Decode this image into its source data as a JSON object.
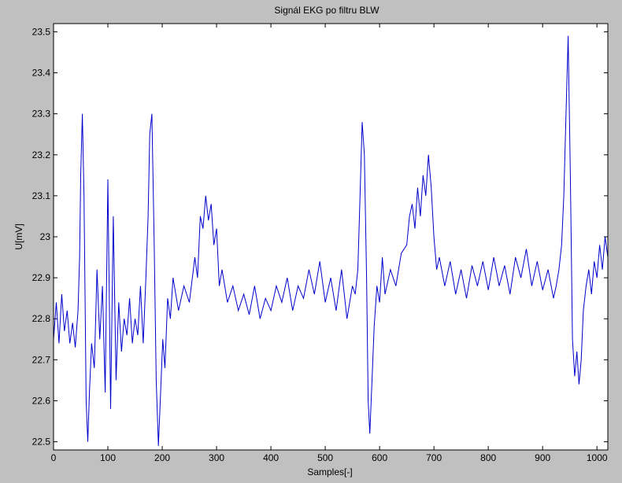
{
  "figure": {
    "background": "#c0c0c0",
    "axes_background": "#ffffff",
    "line_color": "#0000cc"
  },
  "chart_data": {
    "type": "line",
    "title": "Signál EKG po filtru BLW",
    "xlabel": "Samples[-]",
    "ylabel": "U[mV]",
    "xlim": [
      0,
      1020
    ],
    "ylim": [
      22.48,
      23.52
    ],
    "xticks": [
      0,
      100,
      200,
      300,
      400,
      500,
      600,
      700,
      800,
      900,
      1000
    ],
    "xtick_labels": [
      "0",
      "100",
      "200",
      "300",
      "400",
      "500",
      "600",
      "700",
      "800",
      "900",
      "1000"
    ],
    "yticks": [
      22.5,
      22.6,
      22.7,
      22.8,
      22.9,
      23.0,
      23.1,
      23.2,
      23.3,
      23.4,
      23.5
    ],
    "ytick_labels": [
      "22.5",
      "22.6",
      "22.7",
      "22.8",
      "22.9",
      "23",
      "23.1",
      "23.2",
      "23.3",
      "23.4",
      "23.5"
    ],
    "grid": false,
    "series": [
      {
        "color": "#0000cc",
        "x": [
          0,
          5,
          10,
          15,
          20,
          25,
          30,
          35,
          40,
          45,
          48,
          50,
          53,
          56,
          60,
          63,
          66,
          70,
          75,
          80,
          85,
          90,
          95,
          100,
          105,
          110,
          115,
          120,
          125,
          130,
          135,
          140,
          145,
          150,
          155,
          160,
          165,
          170,
          174,
          177,
          181,
          185,
          189,
          193,
          197,
          201,
          205,
          210,
          215,
          220,
          230,
          240,
          250,
          260,
          265,
          270,
          275,
          280,
          285,
          290,
          295,
          300,
          305,
          310,
          320,
          330,
          340,
          350,
          360,
          370,
          380,
          390,
          400,
          410,
          420,
          430,
          440,
          450,
          460,
          470,
          480,
          490,
          500,
          510,
          520,
          530,
          540,
          550,
          555,
          560,
          564,
          568,
          572,
          576,
          579,
          582,
          586,
          590,
          595,
          600,
          605,
          610,
          620,
          630,
          640,
          650,
          655,
          660,
          665,
          670,
          675,
          680,
          685,
          690,
          695,
          700,
          705,
          710,
          720,
          730,
          740,
          750,
          760,
          770,
          780,
          790,
          800,
          810,
          820,
          830,
          840,
          850,
          860,
          870,
          880,
          890,
          900,
          910,
          920,
          925,
          930,
          935,
          939,
          943,
          947,
          951,
          955,
          959,
          963,
          967,
          971,
          975,
          980,
          985,
          990,
          995,
          1000,
          1005,
          1010,
          1015,
          1020
        ],
        "values": [
          22.75,
          22.84,
          22.74,
          22.86,
          22.77,
          22.82,
          22.74,
          22.79,
          22.73,
          22.82,
          22.95,
          23.15,
          23.3,
          23.1,
          22.6,
          22.5,
          22.62,
          22.74,
          22.68,
          22.92,
          22.75,
          22.88,
          22.62,
          23.14,
          22.58,
          23.05,
          22.65,
          22.84,
          22.72,
          22.8,
          22.76,
          22.85,
          22.74,
          22.8,
          22.76,
          22.88,
          22.74,
          22.9,
          23.05,
          23.25,
          23.3,
          23.0,
          22.65,
          22.49,
          22.62,
          22.75,
          22.68,
          22.85,
          22.8,
          22.9,
          22.82,
          22.88,
          22.84,
          22.95,
          22.9,
          23.05,
          23.02,
          23.1,
          23.04,
          23.08,
          22.98,
          23.02,
          22.88,
          22.92,
          22.84,
          22.88,
          22.82,
          22.86,
          22.81,
          22.88,
          22.8,
          22.85,
          22.82,
          22.88,
          22.84,
          22.9,
          22.82,
          22.88,
          22.85,
          22.92,
          22.86,
          22.94,
          22.84,
          22.9,
          22.82,
          22.92,
          22.8,
          22.88,
          22.86,
          22.92,
          23.1,
          23.28,
          23.2,
          22.9,
          22.6,
          22.52,
          22.65,
          22.78,
          22.88,
          22.84,
          22.95,
          22.86,
          22.92,
          22.88,
          22.96,
          22.98,
          23.05,
          23.08,
          23.02,
          23.12,
          23.05,
          23.15,
          23.1,
          23.2,
          23.12,
          23.0,
          22.92,
          22.95,
          22.88,
          22.94,
          22.86,
          22.92,
          22.85,
          22.93,
          22.88,
          22.94,
          22.87,
          22.95,
          22.88,
          22.93,
          22.86,
          22.95,
          22.9,
          22.97,
          22.88,
          22.94,
          22.87,
          22.92,
          22.85,
          22.88,
          22.92,
          22.98,
          23.1,
          23.3,
          23.49,
          23.15,
          22.75,
          22.66,
          22.72,
          22.64,
          22.7,
          22.82,
          22.88,
          22.92,
          22.86,
          22.94,
          22.9,
          22.98,
          22.92,
          23.0,
          22.95
        ]
      }
    ]
  }
}
